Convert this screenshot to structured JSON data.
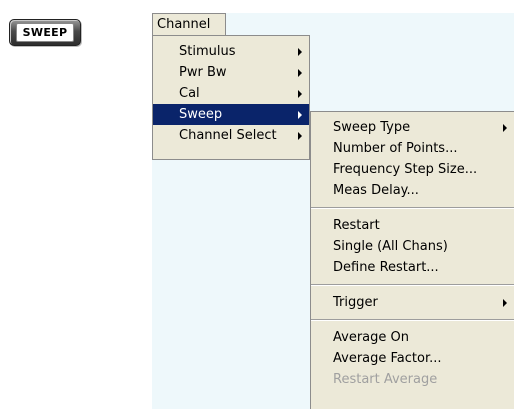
{
  "hardkey": {
    "label": "SWEEP"
  },
  "menubar": {
    "channel_label": "Channel"
  },
  "channel_menu": {
    "items": [
      {
        "label": "Stimulus"
      },
      {
        "label": "Pwr Bw"
      },
      {
        "label": "Cal"
      },
      {
        "label": "Sweep"
      },
      {
        "label": "Channel Select"
      }
    ],
    "selected": "Sweep"
  },
  "sweep_menu": {
    "group1": [
      {
        "label": "Sweep Type"
      },
      {
        "label": "Number of Points..."
      },
      {
        "label": "Frequency Step Size..."
      },
      {
        "label": "Meas Delay..."
      }
    ],
    "group2": [
      {
        "label": "Restart"
      },
      {
        "label": "Single (All Chans)"
      },
      {
        "label": "Define Restart..."
      }
    ],
    "group3": [
      {
        "label": "Trigger"
      }
    ],
    "group4": [
      {
        "label": "Average On"
      },
      {
        "label": "Average Factor..."
      },
      {
        "label": "Restart Average"
      }
    ]
  },
  "colors": {
    "menu_bg": "#ece9d8",
    "highlight": "#0a246a",
    "app_bg": "#eef8fb",
    "disabled_text": "#a0a0a0"
  }
}
